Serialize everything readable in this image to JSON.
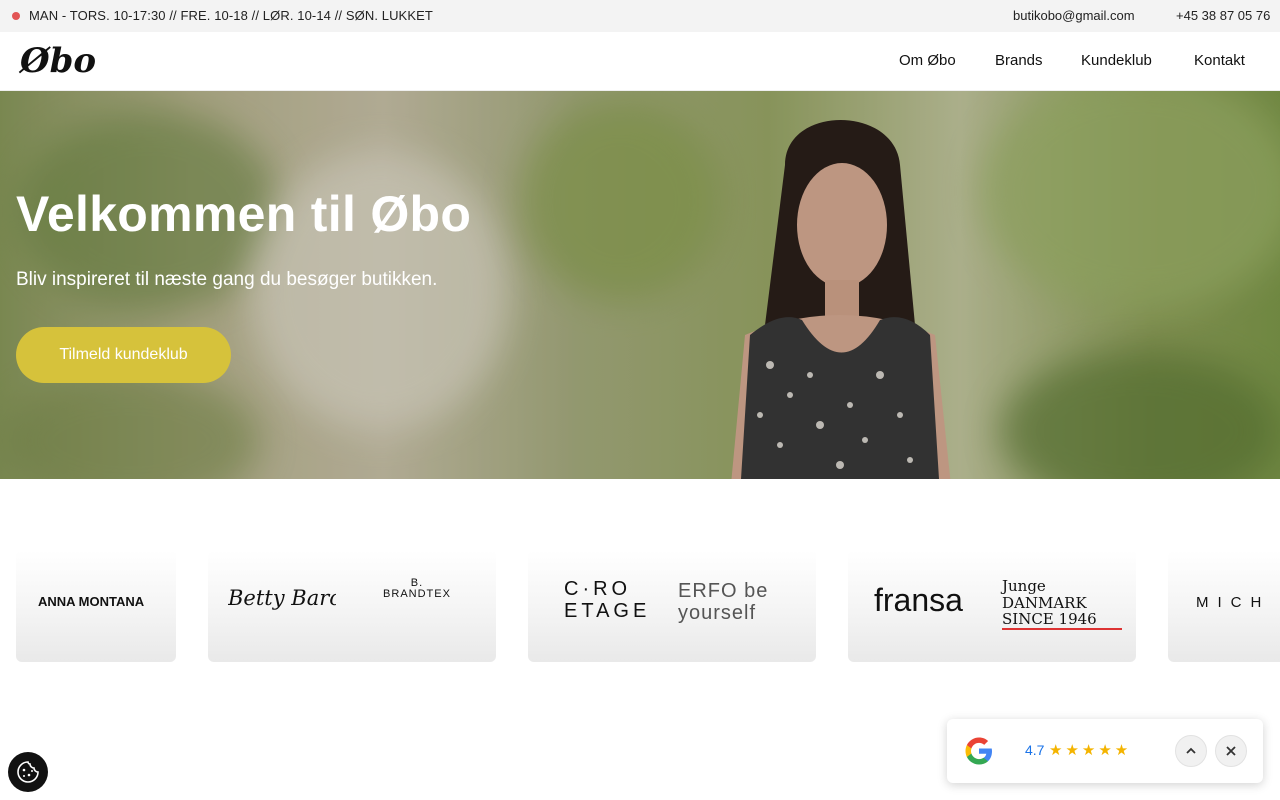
{
  "topbar": {
    "hours": "MAN - TORS. 10-17:30 // FRE. 10-18 // LØR. 10-14 // SØN. LUKKET",
    "email": "butikobo@gmail.com",
    "phone": "+45 38 87 05 76",
    "status_dot_color": "#e25555"
  },
  "header": {
    "logo_text": "Øbo",
    "nav": [
      "Om Øbo",
      "Brands",
      "Kundeklub",
      "Kontakt"
    ]
  },
  "hero": {
    "title": "Velkommen til Øbo",
    "subtitle": "Bliv inspireret til næste gang du besøger butikken.",
    "cta_label": "Tilmeld kundeklub",
    "cta_color": "#d6c23b"
  },
  "brands": [
    "ANNA MONTANA",
    "Betty Barclay",
    "B. BRANDTEX",
    "C·RO ETAGE",
    "ERFO be yourself",
    "fransa",
    "Junge DANMARK SINCE 1946",
    "MICH"
  ],
  "google_badge": {
    "rating": "4.7",
    "stars": "★★★★★",
    "icon": "google-g-icon",
    "expand_icon": "chevron-up-icon",
    "close_icon": "close-icon"
  },
  "cookie": {
    "icon": "cookie-icon"
  }
}
